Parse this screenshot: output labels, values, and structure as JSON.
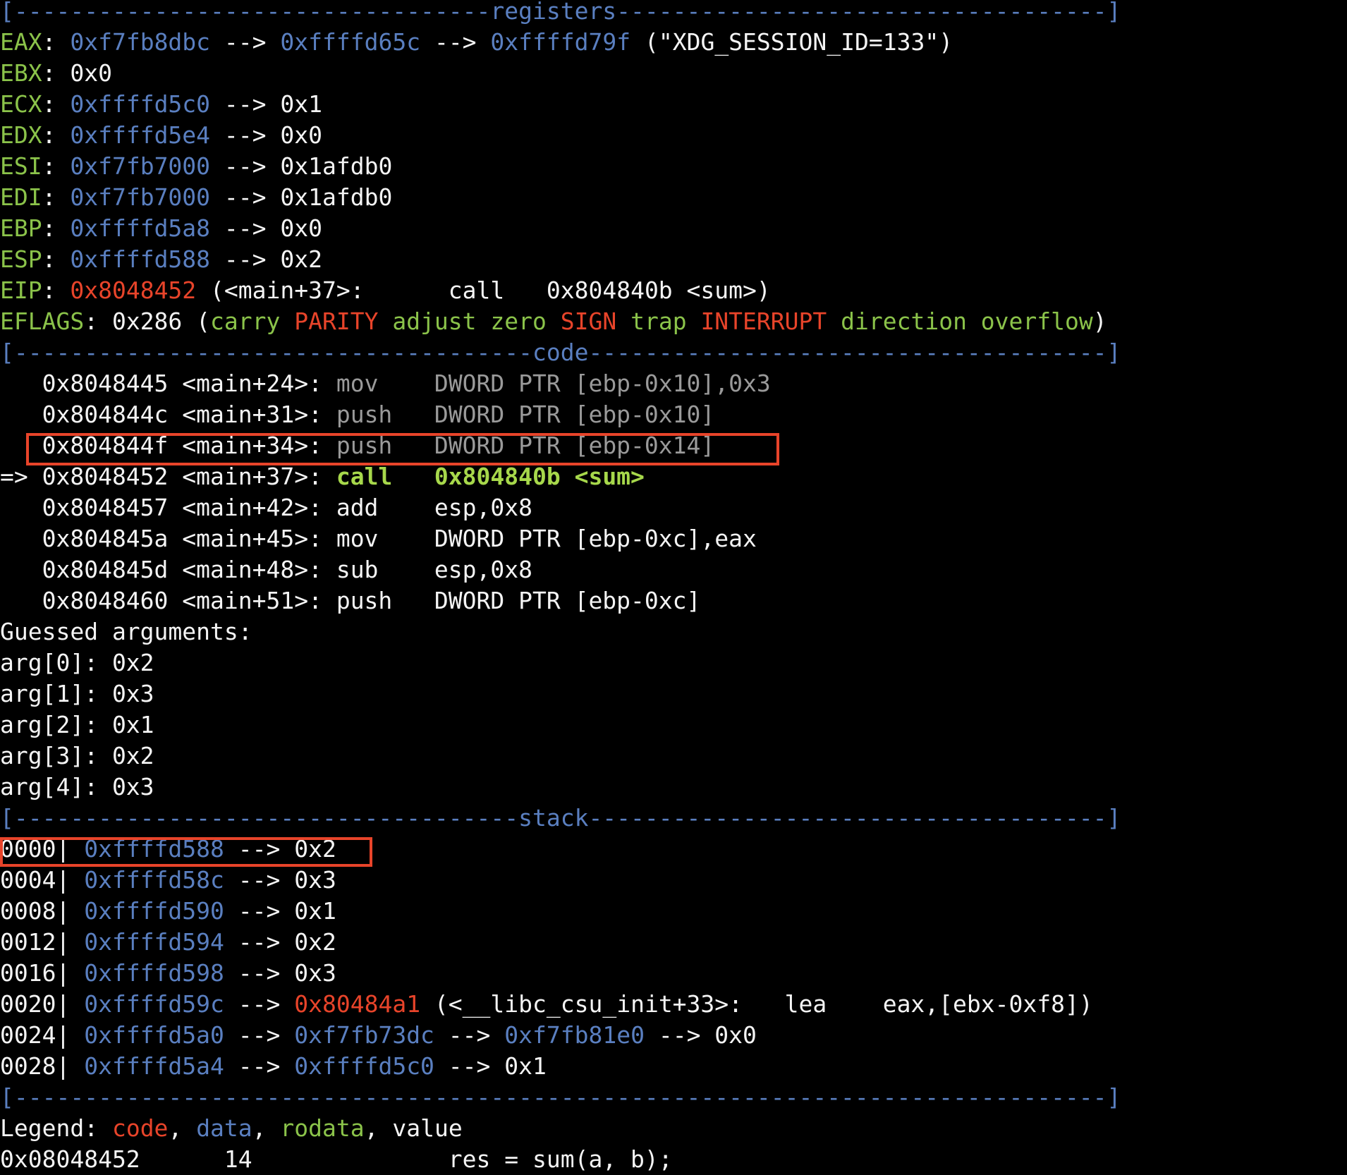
{
  "colors": {
    "background": "#000000",
    "foreground": "#f4f4f4",
    "register_name": "#8bc34a",
    "data_address": "#5a7fc0",
    "code_address": "#e8442a",
    "flag_set": "#e8442a",
    "flag_unset": "#8bc34a",
    "dim_instruction": "#9a9a9a",
    "current_instruction": "#a7d84b",
    "highlight_box": "#e8442a"
  },
  "highlights": [
    {
      "name": "highlight-code-push-ebp-0x14"
    },
    {
      "name": "highlight-stack-0000"
    }
  ],
  "lines": [
    {
      "name": "registers-separator",
      "segs": [
        {
          "t": "[----------------------------------registers-----------------------------------]",
          "c": "blue"
        }
      ]
    },
    {
      "name": "register-eax",
      "segs": [
        {
          "t": "EAX",
          "c": "green"
        },
        {
          "t": ": ",
          "c": "white"
        },
        {
          "t": "0xf7fb8dbc",
          "c": "blue"
        },
        {
          "t": " --> ",
          "c": "white"
        },
        {
          "t": "0xffffd65c",
          "c": "blue"
        },
        {
          "t": " --> ",
          "c": "white"
        },
        {
          "t": "0xffffd79f",
          "c": "blue"
        },
        {
          "t": " (\"XDG_SESSION_ID=133\")",
          "c": "white"
        }
      ]
    },
    {
      "name": "register-ebx",
      "segs": [
        {
          "t": "EBX",
          "c": "green"
        },
        {
          "t": ": 0x0",
          "c": "white"
        }
      ]
    },
    {
      "name": "register-ecx",
      "segs": [
        {
          "t": "ECX",
          "c": "green"
        },
        {
          "t": ": ",
          "c": "white"
        },
        {
          "t": "0xffffd5c0",
          "c": "blue"
        },
        {
          "t": " --> 0x1",
          "c": "white"
        }
      ]
    },
    {
      "name": "register-edx",
      "segs": [
        {
          "t": "EDX",
          "c": "green"
        },
        {
          "t": ": ",
          "c": "white"
        },
        {
          "t": "0xffffd5e4",
          "c": "blue"
        },
        {
          "t": " --> 0x0",
          "c": "white"
        }
      ]
    },
    {
      "name": "register-esi",
      "segs": [
        {
          "t": "ESI",
          "c": "green"
        },
        {
          "t": ": ",
          "c": "white"
        },
        {
          "t": "0xf7fb7000",
          "c": "blue"
        },
        {
          "t": " --> 0x1afdb0",
          "c": "white"
        }
      ]
    },
    {
      "name": "register-edi",
      "segs": [
        {
          "t": "EDI",
          "c": "green"
        },
        {
          "t": ": ",
          "c": "white"
        },
        {
          "t": "0xf7fb7000",
          "c": "blue"
        },
        {
          "t": " --> 0x1afdb0",
          "c": "white"
        }
      ]
    },
    {
      "name": "register-ebp",
      "segs": [
        {
          "t": "EBP",
          "c": "green"
        },
        {
          "t": ": ",
          "c": "white"
        },
        {
          "t": "0xffffd5a8",
          "c": "blue"
        },
        {
          "t": " --> 0x0",
          "c": "white"
        }
      ]
    },
    {
      "name": "register-esp",
      "segs": [
        {
          "t": "ESP",
          "c": "green"
        },
        {
          "t": ": ",
          "c": "white"
        },
        {
          "t": "0xffffd588",
          "c": "blue"
        },
        {
          "t": " --> 0x2",
          "c": "white"
        }
      ]
    },
    {
      "name": "register-eip",
      "segs": [
        {
          "t": "EIP",
          "c": "green"
        },
        {
          "t": ": ",
          "c": "white"
        },
        {
          "t": "0x8048452",
          "c": "red"
        },
        {
          "t": " (<main+37>:      call   0x804840b <sum>)",
          "c": "white"
        }
      ]
    },
    {
      "name": "register-eflags",
      "segs": [
        {
          "t": "EFLAGS",
          "c": "green"
        },
        {
          "t": ": 0x286 (",
          "c": "white"
        },
        {
          "t": "carry ",
          "c": "green"
        },
        {
          "t": "PARITY ",
          "c": "red"
        },
        {
          "t": "adjust zero ",
          "c": "green"
        },
        {
          "t": "SIGN ",
          "c": "red"
        },
        {
          "t": "trap ",
          "c": "green"
        },
        {
          "t": "INTERRUPT ",
          "c": "red"
        },
        {
          "t": "direction overflow",
          "c": "green"
        },
        {
          "t": ")",
          "c": "white"
        }
      ]
    },
    {
      "name": "code-separator",
      "segs": [
        {
          "t": "[-------------------------------------code-------------------------------------]",
          "c": "blue"
        }
      ]
    },
    {
      "name": "code-line-main24",
      "segs": [
        {
          "t": "   0x8048445 <main+24>: ",
          "c": "white"
        },
        {
          "t": "mov    DWORD PTR [ebp-0x10],0x3",
          "c": "gray"
        }
      ]
    },
    {
      "name": "code-line-main31",
      "segs": [
        {
          "t": "   0x804844c <main+31>: ",
          "c": "white"
        },
        {
          "t": "push   DWORD PTR [ebp-0x10]",
          "c": "gray"
        }
      ]
    },
    {
      "name": "code-line-main34",
      "segs": [
        {
          "t": "   0x804844f <main+34>: ",
          "c": "white"
        },
        {
          "t": "push   DWORD PTR [ebp-0x14]",
          "c": "gray"
        }
      ]
    },
    {
      "name": "code-line-main37-current",
      "segs": [
        {
          "t": "=> 0x8048452 <main+37>: ",
          "c": "white"
        },
        {
          "t": "call   0x804840b <sum>",
          "c": "bgreen"
        }
      ]
    },
    {
      "name": "code-line-main42",
      "segs": [
        {
          "t": "   0x8048457 <main+42>: add    esp,0x8",
          "c": "white"
        }
      ]
    },
    {
      "name": "code-line-main45",
      "segs": [
        {
          "t": "   0x804845a <main+45>: mov    DWORD PTR [ebp-0xc],eax",
          "c": "white"
        }
      ]
    },
    {
      "name": "code-line-main48",
      "segs": [
        {
          "t": "   0x804845d <main+48>: sub    esp,0x8",
          "c": "white"
        }
      ]
    },
    {
      "name": "code-line-main51",
      "segs": [
        {
          "t": "   0x8048460 <main+51>: push   DWORD PTR [ebp-0xc]",
          "c": "white"
        }
      ]
    },
    {
      "name": "guessed-arguments-heading",
      "segs": [
        {
          "t": "Guessed arguments:",
          "c": "white"
        }
      ]
    },
    {
      "name": "argument-0",
      "segs": [
        {
          "t": "arg[0]: 0x2",
          "c": "white"
        }
      ]
    },
    {
      "name": "argument-1",
      "segs": [
        {
          "t": "arg[1]: 0x3",
          "c": "white"
        }
      ]
    },
    {
      "name": "argument-2",
      "segs": [
        {
          "t": "arg[2]: 0x1",
          "c": "white"
        }
      ]
    },
    {
      "name": "argument-3",
      "segs": [
        {
          "t": "arg[3]: 0x2",
          "c": "white"
        }
      ]
    },
    {
      "name": "argument-4",
      "segs": [
        {
          "t": "arg[4]: 0x3",
          "c": "white"
        }
      ]
    },
    {
      "name": "stack-separator",
      "segs": [
        {
          "t": "[------------------------------------stack-------------------------------------]",
          "c": "blue"
        }
      ]
    },
    {
      "name": "stack-entry-0000",
      "segs": [
        {
          "t": "0000| ",
          "c": "white"
        },
        {
          "t": "0xffffd588",
          "c": "blue"
        },
        {
          "t": " --> 0x2",
          "c": "white"
        }
      ]
    },
    {
      "name": "stack-entry-0004",
      "segs": [
        {
          "t": "0004| ",
          "c": "white"
        },
        {
          "t": "0xffffd58c",
          "c": "blue"
        },
        {
          "t": " --> 0x3",
          "c": "white"
        }
      ]
    },
    {
      "name": "stack-entry-0008",
      "segs": [
        {
          "t": "0008| ",
          "c": "white"
        },
        {
          "t": "0xffffd590",
          "c": "blue"
        },
        {
          "t": " --> 0x1",
          "c": "white"
        }
      ]
    },
    {
      "name": "stack-entry-0012",
      "segs": [
        {
          "t": "0012| ",
          "c": "white"
        },
        {
          "t": "0xffffd594",
          "c": "blue"
        },
        {
          "t": " --> 0x2",
          "c": "white"
        }
      ]
    },
    {
      "name": "stack-entry-0016",
      "segs": [
        {
          "t": "0016| ",
          "c": "white"
        },
        {
          "t": "0xffffd598",
          "c": "blue"
        },
        {
          "t": " --> 0x3",
          "c": "white"
        }
      ]
    },
    {
      "name": "stack-entry-0020",
      "segs": [
        {
          "t": "0020| ",
          "c": "white"
        },
        {
          "t": "0xffffd59c",
          "c": "blue"
        },
        {
          "t": " --> ",
          "c": "white"
        },
        {
          "t": "0x80484a1",
          "c": "red"
        },
        {
          "t": " (<__libc_csu_init+33>:   lea    eax,[ebx-0xf8])",
          "c": "white"
        }
      ]
    },
    {
      "name": "stack-entry-0024",
      "segs": [
        {
          "t": "0024| ",
          "c": "white"
        },
        {
          "t": "0xffffd5a0",
          "c": "blue"
        },
        {
          "t": " --> ",
          "c": "white"
        },
        {
          "t": "0xf7fb73dc",
          "c": "blue"
        },
        {
          "t": " --> ",
          "c": "white"
        },
        {
          "t": "0xf7fb81e0",
          "c": "blue"
        },
        {
          "t": " --> 0x0",
          "c": "white"
        }
      ]
    },
    {
      "name": "stack-entry-0028",
      "segs": [
        {
          "t": "0028| ",
          "c": "white"
        },
        {
          "t": "0xffffd5a4",
          "c": "blue"
        },
        {
          "t": " --> ",
          "c": "white"
        },
        {
          "t": "0xffffd5c0",
          "c": "blue"
        },
        {
          "t": " --> 0x1",
          "c": "white"
        }
      ]
    },
    {
      "name": "bottom-separator",
      "segs": [
        {
          "t": "[------------------------------------------------------------------------------]",
          "c": "blue"
        }
      ]
    },
    {
      "name": "legend-line",
      "segs": [
        {
          "t": "Legend: ",
          "c": "white"
        },
        {
          "t": "code",
          "c": "red"
        },
        {
          "t": ", ",
          "c": "white"
        },
        {
          "t": "data",
          "c": "blue"
        },
        {
          "t": ", ",
          "c": "white"
        },
        {
          "t": "rodata",
          "c": "green"
        },
        {
          "t": ", value",
          "c": "white"
        }
      ]
    },
    {
      "name": "source-line",
      "segs": [
        {
          "t": "0x08048452      14              res = sum(a, b);",
          "c": "white"
        }
      ]
    }
  ]
}
